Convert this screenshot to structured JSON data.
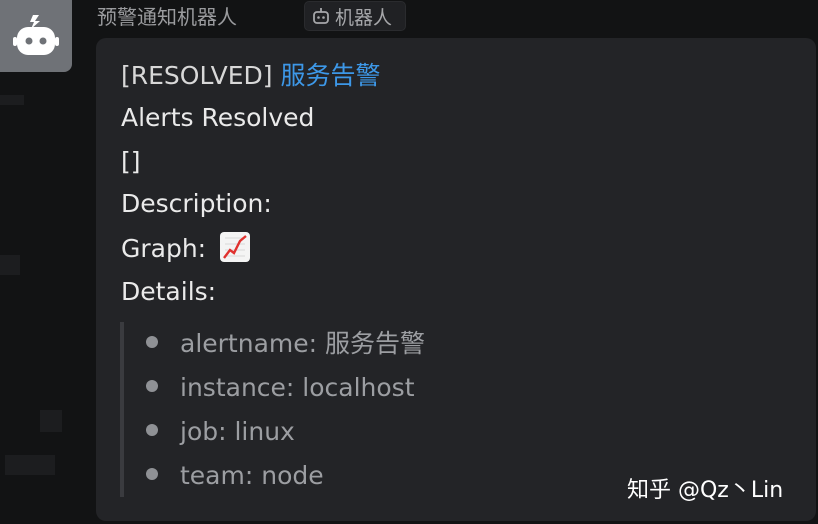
{
  "sender": {
    "name": "预警通知机器人",
    "badge_label": "机器人"
  },
  "message": {
    "title_prefix": "[RESOLVED]",
    "title_link": "服务告警",
    "status": "Alerts Resolved",
    "list_marker": "[]",
    "description_label": "Description:",
    "graph_label": "Graph:",
    "graph_icon": "chart-increasing-icon",
    "details_label": "Details:",
    "details": [
      "alertname: 服务告警",
      "instance: localhost",
      "job: linux",
      "team: node"
    ]
  },
  "watermark": "知乎 @Qz丶Lin",
  "colors": {
    "link": "#3d98e8",
    "card_bg": "#232427",
    "page_bg": "#121314"
  }
}
